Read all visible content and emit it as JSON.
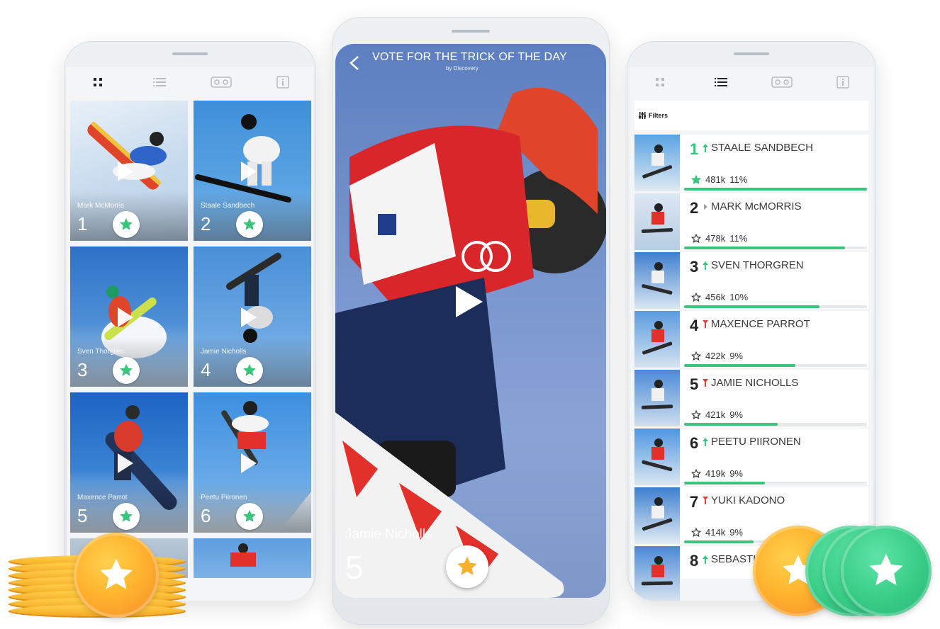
{
  "colors": {
    "accent_green": "#3bc47b",
    "gold_star": "#f9b02a",
    "trend_up": "#3bc47b",
    "trend_down": "#e2403a"
  },
  "left_screen": {
    "tabs": [
      {
        "icon": "grid-icon",
        "active": true
      },
      {
        "icon": "list-icon",
        "active": false
      },
      {
        "icon": "vr-headset-icon",
        "active": false
      },
      {
        "icon": "info-icon",
        "active": false
      }
    ],
    "cards": [
      {
        "name": "Mark McMorris",
        "number": "1"
      },
      {
        "name": "Staale Sandbech",
        "number": "2"
      },
      {
        "name": "Sven Thorgren",
        "number": "3"
      },
      {
        "name": "Jamie Nicholls",
        "number": "4"
      },
      {
        "name": "Maxence Parrot",
        "number": "5"
      },
      {
        "name": "Peetu Piironen",
        "number": "6"
      },
      {
        "name": "",
        "number": ""
      },
      {
        "name": "",
        "number": ""
      }
    ]
  },
  "middle_screen": {
    "title": "VOTE FOR THE TRICK OF THE DAY",
    "subtitle": "by Discovery",
    "rider_name": "Jamie Nicholls",
    "rider_number": "5"
  },
  "right_screen": {
    "filters_label": "Filters",
    "rankings": [
      {
        "rank": "1",
        "trend": "up",
        "name": "STAALE SANDBECH",
        "votes": "481k",
        "percent": "11%",
        "share": 1.0,
        "starred": true
      },
      {
        "rank": "2",
        "trend": "same",
        "name": "MARK McMORRIS",
        "votes": "478k",
        "percent": "11%",
        "share": 0.88,
        "starred": false
      },
      {
        "rank": "3",
        "trend": "up",
        "name": "SVEN THORGREN",
        "votes": "456k",
        "percent": "10%",
        "share": 0.74,
        "starred": false
      },
      {
        "rank": "4",
        "trend": "down",
        "name": "MAXENCE PARROT",
        "votes": "422k",
        "percent": "9%",
        "share": 0.61,
        "starred": false
      },
      {
        "rank": "5",
        "trend": "down",
        "name": "JAMIE NICHOLLS",
        "votes": "421k",
        "percent": "9%",
        "share": 0.51,
        "starred": false
      },
      {
        "rank": "6",
        "trend": "up",
        "name": "PEETU PIIRONEN",
        "votes": "419k",
        "percent": "9%",
        "share": 0.44,
        "starred": false
      },
      {
        "rank": "7",
        "trend": "down",
        "name": "YUKI KADONO",
        "votes": "414k",
        "percent": "9%",
        "share": 0.38,
        "starred": false
      },
      {
        "rank": "8",
        "trend": "up",
        "name": "SEBASTI",
        "votes": "",
        "percent": "",
        "share": 0.3,
        "starred": false
      }
    ]
  }
}
